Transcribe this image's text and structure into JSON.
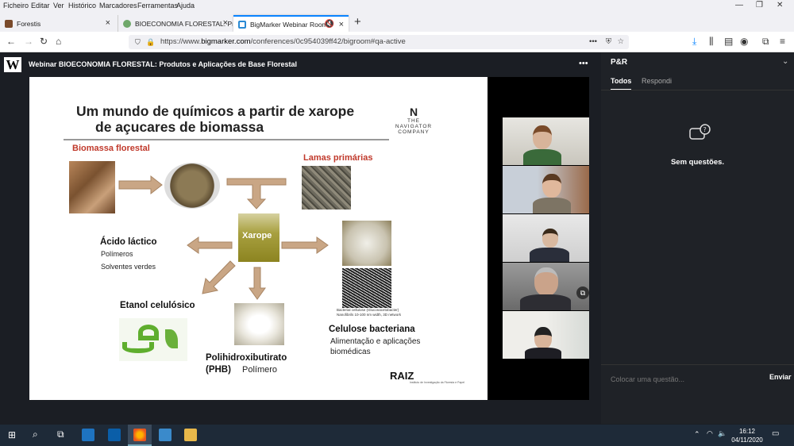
{
  "menu": [
    "Ficheiro",
    "Editar",
    "Ver",
    "Histórico",
    "Marcadores",
    "Ferramentas",
    "Ajuda"
  ],
  "window_controls": {
    "min": "—",
    "max": "❐",
    "close": "✕"
  },
  "tabs": [
    {
      "label": "Forestis",
      "active": false
    },
    {
      "label": "BIOECONOMIA FLORESTAL: Pro",
      "active": false
    },
    {
      "label": "BigMarker Webinar Room",
      "active": true
    }
  ],
  "new_tab": "+",
  "url": {
    "prefix": "https://www.",
    "domain": "bigmarker.com",
    "path": "/conferences/0c954039ff42/bigroom#qa-active"
  },
  "webinar": {
    "logo": "W",
    "title": "Webinar BIOECONOMIA FLORESTAL: Produtos e Aplicações de Base Florestal",
    "more": "•••"
  },
  "slide": {
    "title_line1": "Um mundo de químicos a partir de xarope",
    "title_line2": "de açucares de biomassa",
    "navigator_logo": "THE NAVIGATOR COMPANY",
    "biomassa": "Biomassa florestal",
    "lamas": "Lamas primárias",
    "xarope": "Xarope",
    "acido": "Ácido láctico",
    "polimeros": "Polímeros",
    "solventes": "Solventes verdes",
    "etanol": "Etanol celulósico",
    "phb_line1": "Polihidroxibutirato",
    "phb_line2": "(PHB)",
    "phb_sub": "Polímero",
    "celulose": "Celulose bacteriana",
    "celulose_sub1": "Alimentação e aplicações",
    "celulose_sub2": "biomédicas",
    "caption1": "Bacterial cellulose (Gluconacetobacter)",
    "caption2": "Nanofibrils 10-100 nm width, 3D network",
    "raiz": "RAIZ",
    "raiz_sub": "Instituto de Investigação da Floresta e Papel"
  },
  "qa": {
    "title": "P&R",
    "tabs": [
      "Todos",
      "Respondi"
    ],
    "empty": "Sem questões.",
    "placeholder": "Colocar uma questão...",
    "send": "Enviar"
  },
  "taskbar": {
    "time": "16:12",
    "date": "04/11/2020"
  }
}
